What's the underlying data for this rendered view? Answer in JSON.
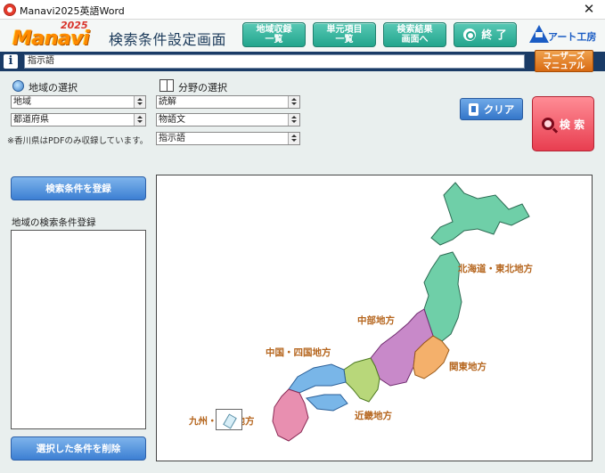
{
  "window": {
    "title": "Manavi2025英語Word",
    "close_glyph": "✕"
  },
  "header": {
    "logo_text": "Manavi",
    "logo_year": "2025",
    "page_title": "検索条件設定画面",
    "buttons": {
      "region_list": [
        "地域収録",
        "一覧"
      ],
      "unit_list": [
        "単元項目",
        "一覧"
      ],
      "to_results": [
        "検索結果",
        "画面へ"
      ],
      "exit": "終 了"
    },
    "brand": "アート工房",
    "accent_color": "#23a58d"
  },
  "info": {
    "icon_glyph": "i",
    "text": "指示語"
  },
  "manual_button": [
    "ユーザーズ",
    "マニュアル"
  ],
  "region_select": {
    "label": "地域の選択",
    "region": "地域",
    "prefecture": "都道府県"
  },
  "field_select": {
    "label": "分野の選択",
    "field": "読解",
    "subfield": "物語文",
    "detail": "指示語"
  },
  "note": "※香川県はPDFのみ収録しています。",
  "clear_button": "クリア",
  "search_button": "検 索",
  "register_button": "検索条件を登録",
  "list_label": "地域の検索条件登録",
  "delete_button": "選択した条件を削除",
  "map": {
    "regions": [
      {
        "name": "北海道・東北地方",
        "color": "#6fcfa8"
      },
      {
        "name": "中部地方",
        "color": "#c889c9"
      },
      {
        "name": "関東地方",
        "color": "#f4b06b"
      },
      {
        "name": "近畿地方",
        "color": "#b8d77a"
      },
      {
        "name": "中国・四国地方",
        "color": "#79b6e8"
      },
      {
        "name": "九州・沖縄地方",
        "color": "#e88fb0"
      }
    ]
  }
}
